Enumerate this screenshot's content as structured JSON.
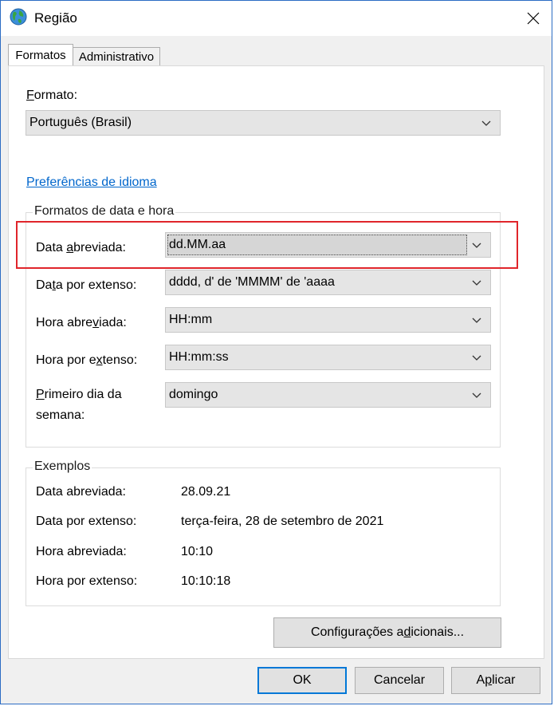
{
  "window": {
    "title": "Região"
  },
  "tabs": [
    {
      "label": "Formatos",
      "active": true
    },
    {
      "label": "Administrativo",
      "active": false
    }
  ],
  "format": {
    "label_pre": "",
    "label_mnemonic": "F",
    "label_post": "ormato:",
    "selected": "Português (Brasil)"
  },
  "language_link": "Preferências de idioma",
  "date_time_group": {
    "title": "Formatos de data e hora",
    "rows": [
      {
        "label_pre": "Data ",
        "label_mnemonic": "a",
        "label_post": "breviada:",
        "value": "dd.MM.aa"
      },
      {
        "label_pre": "Da",
        "label_mnemonic": "t",
        "label_post": "a por extenso:",
        "value": "dddd, d' de 'MMMM' de 'aaaa"
      },
      {
        "label_pre": "Hora abre",
        "label_mnemonic": "v",
        "label_post": "iada:",
        "value": "HH:mm"
      },
      {
        "label_pre": "Hora por e",
        "label_mnemonic": "x",
        "label_post": "tenso:",
        "value": "HH:mm:ss"
      },
      {
        "label_pre": "",
        "label_mnemonic": "P",
        "label_post": "rimeiro dia da",
        "label_line2": "semana:",
        "value": "domingo"
      }
    ]
  },
  "examples": {
    "title": "Exemplos",
    "rows": [
      {
        "label": "Data abreviada:",
        "value": "28.09.21"
      },
      {
        "label": "Data por extenso:",
        "value": "terça-feira, 28 de setembro de 2021"
      },
      {
        "label": "Hora abreviada:",
        "value": "10:10"
      },
      {
        "label": "Hora por extenso:",
        "value": "10:10:18"
      }
    ]
  },
  "buttons": {
    "additional_pre": "Configurações a",
    "additional_mnemonic": "d",
    "additional_post": "icionais...",
    "ok": "OK",
    "cancel": "Cancelar",
    "apply_pre": "A",
    "apply_mnemonic": "p",
    "apply_post": "licar"
  },
  "colors": {
    "highlight": "#e0252b",
    "link": "#0066cc",
    "focus_border": "#0078d7"
  },
  "icons": {
    "title": "globe-icon",
    "close": "close-icon",
    "chevron": "chevron-down-icon"
  }
}
